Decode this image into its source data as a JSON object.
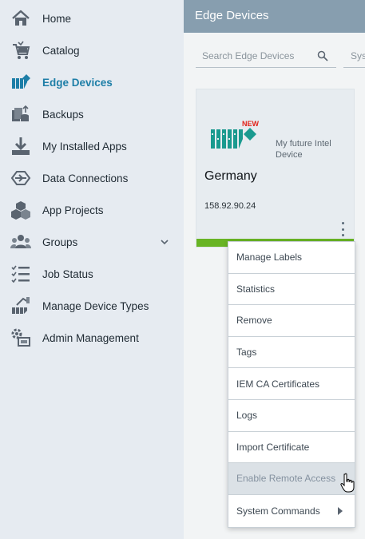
{
  "sidebar": {
    "items": [
      {
        "label": "Home",
        "icon": "home-icon"
      },
      {
        "label": "Catalog",
        "icon": "cart-icon"
      },
      {
        "label": "Edge Devices",
        "icon": "edge-device-icon",
        "active": true
      },
      {
        "label": "Backups",
        "icon": "backup-icon"
      },
      {
        "label": "My Installed Apps",
        "icon": "download-icon"
      },
      {
        "label": "Data Connections",
        "icon": "data-connection-icon"
      },
      {
        "label": "App Projects",
        "icon": "cubes-icon"
      },
      {
        "label": "Groups",
        "icon": "users-icon",
        "expandable": true
      },
      {
        "label": "Job Status",
        "icon": "checklist-icon"
      },
      {
        "label": "Manage Device Types",
        "icon": "device-types-icon"
      },
      {
        "label": "Admin Management",
        "icon": "admin-icon"
      }
    ]
  },
  "header": {
    "title": "Edge Devices"
  },
  "search": {
    "placeholder": "Search Edge Devices",
    "second_placeholder": "Sys"
  },
  "device_card": {
    "badge": "NEW",
    "device_type": "My future Intel Device",
    "name": "Germany",
    "ip": "158.92.90.24",
    "status_color": "#68b424"
  },
  "context_menu": {
    "items": [
      "Manage Labels",
      "Statistics",
      "Remove",
      "Tags",
      "IEM CA Certificates",
      "Logs",
      "Import Certificate",
      "Enable Remote Access",
      "System Commands"
    ],
    "hovered": "Enable Remote Access"
  },
  "colors": {
    "accent": "#1d7ea7",
    "header": "#879eaf",
    "sidebar": "#e6ebf1"
  }
}
